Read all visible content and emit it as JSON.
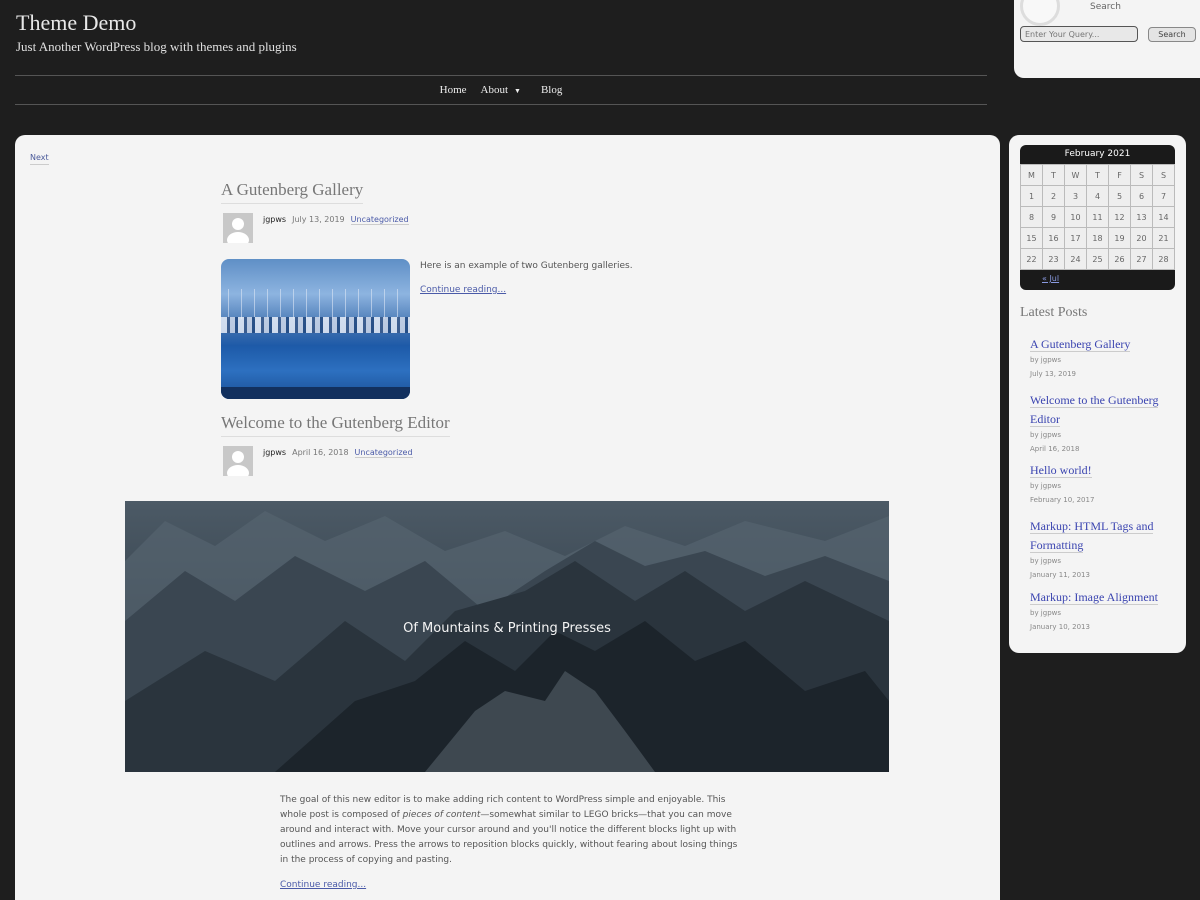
{
  "site": {
    "title": "Theme Demo",
    "description": "Just Another WordPress blog with themes and plugins"
  },
  "search": {
    "label": "Search",
    "placeholder": "Enter Your Query...",
    "button": "Search"
  },
  "nav": {
    "home": "Home",
    "about": "About",
    "about_arrow": "▼",
    "blog": "Blog"
  },
  "pagination": {
    "next": "Next"
  },
  "posts": [
    {
      "title": "A Gutenberg Gallery",
      "author": "jgpws",
      "date": "July 13, 2019",
      "category": "Uncategorized",
      "excerpt": "Here is an example of two Gutenberg galleries.",
      "continue": "Continue reading..."
    },
    {
      "title": "Welcome to the Gutenberg Editor",
      "author": "jgpws",
      "date": "April 16, 2018",
      "category": "Uncategorized",
      "cover_text": "Of Mountains & Printing Presses",
      "body_1": "The goal of this new editor is to make adding rich content to WordPress simple and enjoyable. This whole post is composed of ",
      "body_em": "pieces of content",
      "body_2": "—somewhat similar to LEGO bricks—that you can move around and interact with. Move your cursor around and you'll notice the different blocks light up with outlines and arrows. Press the arrows to reposition blocks quickly, without fearing about losing things in the process of copying and pasting.",
      "continue": "Continue reading..."
    }
  ],
  "calendar": {
    "caption": "February 2021",
    "days": [
      "M",
      "T",
      "W",
      "T",
      "F",
      "S",
      "S"
    ],
    "weeks": [
      [
        "1",
        "2",
        "3",
        "4",
        "5",
        "6",
        "7"
      ],
      [
        "8",
        "9",
        "10",
        "11",
        "12",
        "13",
        "14"
      ],
      [
        "15",
        "16",
        "17",
        "18",
        "19",
        "20",
        "21"
      ],
      [
        "22",
        "23",
        "24",
        "25",
        "26",
        "27",
        "28"
      ]
    ],
    "prev": "« Jul"
  },
  "latest_posts": {
    "title": "Latest Posts",
    "items": [
      {
        "title": "A Gutenberg Gallery",
        "by": "by jgpws",
        "date": "July 13, 2019"
      },
      {
        "title": "Welcome to the Gutenberg Editor",
        "by": "by jgpws",
        "date": "April 16, 2018"
      },
      {
        "title": "Hello world!",
        "by": "by jgpws",
        "date": "February 10, 2017"
      },
      {
        "title": "Markup: HTML Tags and Formatting",
        "by": "by jgpws",
        "date": "January 11, 2013"
      },
      {
        "title": "Markup: Image Alignment",
        "by": "by jgpws",
        "date": "January 10, 2013"
      }
    ]
  }
}
